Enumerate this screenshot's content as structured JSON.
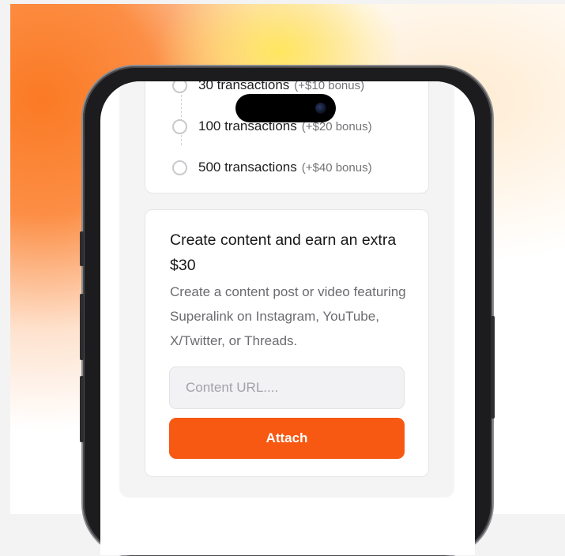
{
  "transactions": [
    {
      "label": "30 transactions",
      "bonus": "(+$10 bonus)"
    },
    {
      "label": "100 transactions",
      "bonus": "(+$20 bonus)"
    },
    {
      "label": "500 transactions",
      "bonus": "(+$40 bonus)"
    }
  ],
  "content_card": {
    "title": "Create content and earn an extra $30",
    "description": "Create a content post or video featuring Superalink on Instagram, YouTube, X/Twitter, or Threads.",
    "url_placeholder": "Content URL....",
    "url_value": "",
    "attach_label": "Attach"
  },
  "colors": {
    "accent": "#f75812",
    "gradient_orange": "#fb7a24",
    "gradient_yellow": "#ffe65a"
  }
}
